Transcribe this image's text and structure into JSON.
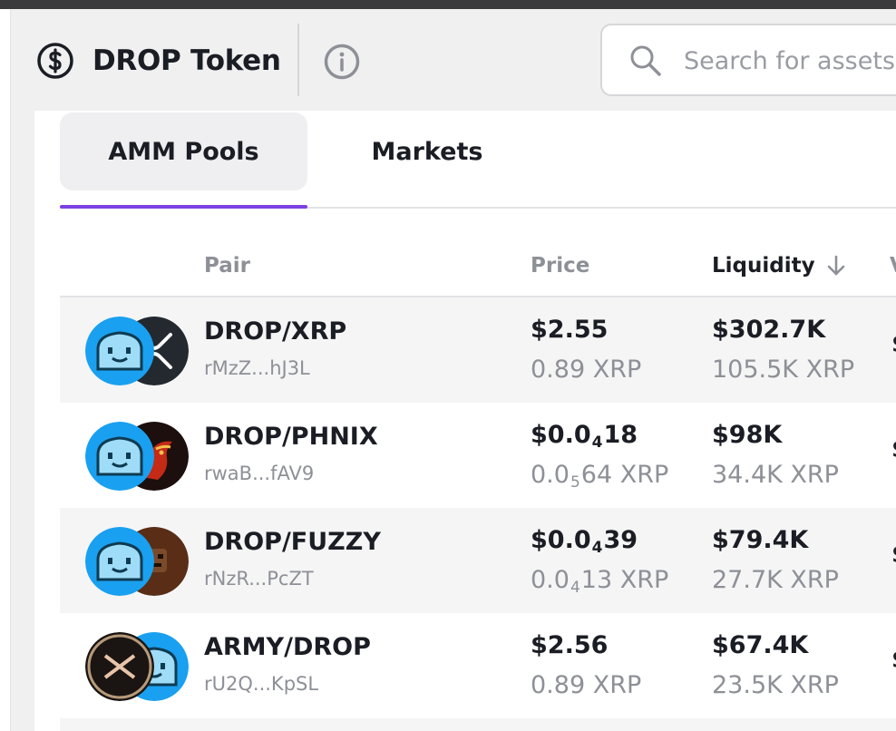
{
  "header": {
    "title": "DROP Token",
    "search_placeholder": "Search for assets"
  },
  "tabs": [
    {
      "label": "AMM Pools",
      "active": true
    },
    {
      "label": "Markets",
      "active": false
    }
  ],
  "columns": {
    "pair": "Pair",
    "price": "Price",
    "liquidity": "Liquidity",
    "volume_partial": "V"
  },
  "rows": [
    {
      "pair": "DROP/XRP",
      "address": "rMzZ...hJ3L",
      "price_usd": "$2.55",
      "price_xrp": "0.89 XRP",
      "liquidity_usd": "$302.7K",
      "liquidity_xrp": "105.5K XRP",
      "volume_partial": "$",
      "icons": [
        "drop-token-icon",
        "xrp-token-icon"
      ]
    },
    {
      "pair": "DROP/PHNIX",
      "address": "rwaB...fAV9",
      "price_usd": {
        "pre": "$0.0",
        "sub": "4",
        "post": "18"
      },
      "price_xrp": {
        "pre": "0.0",
        "sub": "5",
        "post": "64 XRP"
      },
      "liquidity_usd": "$98K",
      "liquidity_xrp": "34.4K XRP",
      "volume_partial": "$",
      "icons": [
        "drop-token-icon",
        "phnix-token-icon"
      ]
    },
    {
      "pair": "DROP/FUZZY",
      "address": "rNzR...PcZT",
      "price_usd": {
        "pre": "$0.0",
        "sub": "4",
        "post": "39"
      },
      "price_xrp": {
        "pre": "0.0",
        "sub": "4",
        "post": "13 XRP"
      },
      "liquidity_usd": "$79.4K",
      "liquidity_xrp": "27.7K XRP",
      "volume_partial": "$",
      "icons": [
        "drop-token-icon",
        "fuzzy-token-icon"
      ]
    },
    {
      "pair": "ARMY/DROP",
      "address": "rU2Q...KpSL",
      "price_usd": "$2.56",
      "price_xrp": "0.89 XRP",
      "liquidity_usd": "$67.4K",
      "liquidity_xrp": "23.5K XRP",
      "volume_partial": "$",
      "icons": [
        "army-token-icon",
        "drop-token-icon"
      ]
    }
  ],
  "colors": {
    "accent": "#7b3fe4",
    "drop_blue": "#1aa0f0",
    "text_primary": "#1b1d24",
    "text_muted": "#8e9097"
  }
}
